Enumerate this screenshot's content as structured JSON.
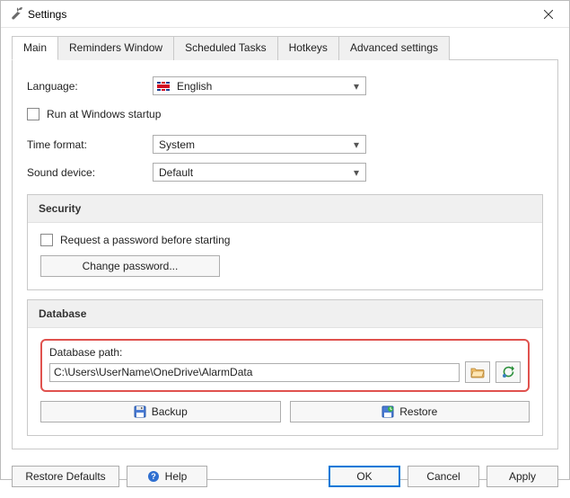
{
  "window": {
    "title": "Settings"
  },
  "tabs": [
    {
      "label": "Main"
    },
    {
      "label": "Reminders Window"
    },
    {
      "label": "Scheduled Tasks"
    },
    {
      "label": "Hotkeys"
    },
    {
      "label": "Advanced settings"
    }
  ],
  "main": {
    "language_label": "Language:",
    "language_value": "English",
    "run_at_startup_label": "Run at Windows startup",
    "time_format_label": "Time format:",
    "time_format_value": "System",
    "sound_device_label": "Sound device:",
    "sound_device_value": "Default"
  },
  "security": {
    "legend": "Security",
    "request_password_label": "Request a password before starting",
    "change_password_label": "Change password..."
  },
  "database": {
    "legend": "Database",
    "path_label": "Database path:",
    "path_value": "C:\\Users\\UserName\\OneDrive\\AlarmData",
    "backup_label": "Backup",
    "restore_label": "Restore"
  },
  "footer": {
    "restore_defaults": "Restore Defaults",
    "help": "Help",
    "ok": "OK",
    "cancel": "Cancel",
    "apply": "Apply"
  }
}
